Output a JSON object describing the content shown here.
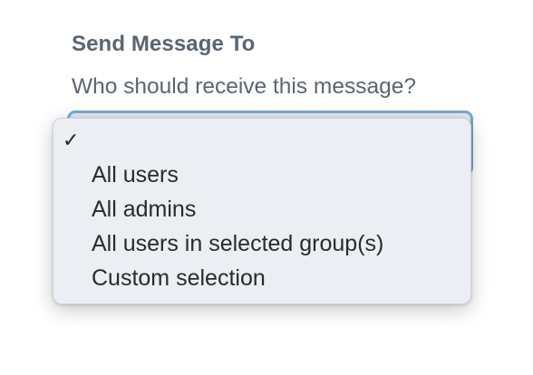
{
  "field": {
    "title": "Send Message To",
    "description": "Who should receive this message?"
  },
  "dropdown": {
    "selected_index": 0,
    "check_glyph": "✓",
    "options": [
      {
        "label": ""
      },
      {
        "label": "All users"
      },
      {
        "label": "All admins"
      },
      {
        "label": "All users in selected group(s)"
      },
      {
        "label": "Custom selection"
      }
    ]
  }
}
